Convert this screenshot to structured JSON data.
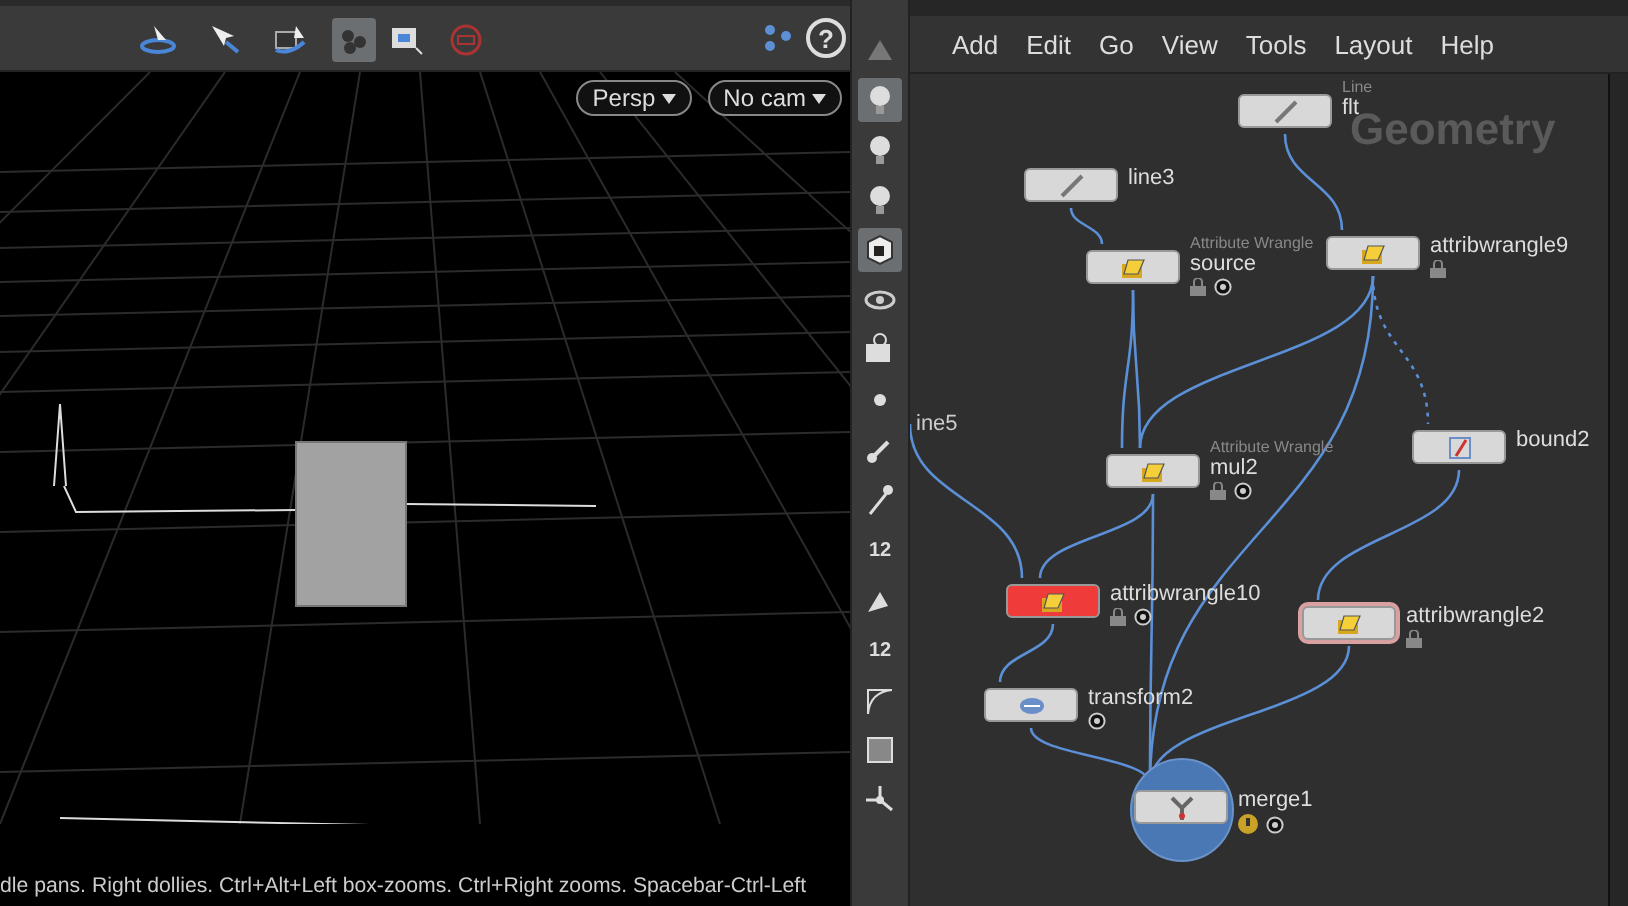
{
  "viewport": {
    "toolbar": [
      {
        "kind": "orbit",
        "selected": false
      },
      {
        "kind": "select",
        "selected": false
      },
      {
        "kind": "transform",
        "selected": false
      },
      {
        "kind": "snap",
        "selected": true
      },
      {
        "kind": "zoom",
        "selected": false
      },
      {
        "kind": "record",
        "selected": false
      }
    ],
    "help": "?",
    "camera_menus": [
      "Persp",
      "No cam"
    ],
    "status": "dle pans. Right dollies. Ctrl+Alt+Left box-zooms. Ctrl+Right zooms. Spacebar-Ctrl-Left"
  },
  "tools": [
    {
      "kind": "up",
      "selected": false
    },
    {
      "kind": "bulb",
      "selected": true
    },
    {
      "kind": "bulb",
      "selected": false
    },
    {
      "kind": "bulb",
      "selected": false
    },
    {
      "kind": "cube",
      "selected": true
    },
    {
      "kind": "eye",
      "selected": false
    },
    {
      "kind": "camera",
      "selected": false
    },
    {
      "kind": "dot",
      "selected": false
    },
    {
      "kind": "brush",
      "selected": false
    },
    {
      "kind": "pin",
      "selected": false
    },
    {
      "kind": "number",
      "text": "12",
      "selected": false
    },
    {
      "kind": "paint",
      "selected": false
    },
    {
      "kind": "number",
      "text": "12",
      "selected": false
    },
    {
      "kind": "curve",
      "selected": false
    },
    {
      "kind": "square",
      "selected": false
    },
    {
      "kind": "axes",
      "selected": false
    }
  ],
  "network": {
    "menu": [
      "Add",
      "Edit",
      "Go",
      "View",
      "Tools",
      "Layout",
      "Help"
    ],
    "context_label": "Geometry",
    "edge_label": "ine5",
    "nodes": [
      {
        "name": "flt",
        "type_label": "Line",
        "kind": "line",
        "color": "#d8d8d8",
        "locked": false,
        "flagged": false,
        "warning": false,
        "selected": false,
        "outlined": false
      },
      {
        "name": "line3",
        "kind": "line",
        "color": "#d8d8d8",
        "locked": false,
        "flagged": false,
        "warning": false,
        "selected": false,
        "outlined": false
      },
      {
        "name": "source",
        "type_label": "Attribute Wrangle",
        "kind": "wrangle",
        "color": "#d8d8d8",
        "locked": true,
        "flagged": true,
        "warning": false,
        "selected": false,
        "outlined": false
      },
      {
        "name": "attribwrangle9",
        "kind": "wrangle",
        "color": "#d8d8d8",
        "locked": true,
        "flagged": false,
        "warning": false,
        "selected": false,
        "outlined": false
      },
      {
        "name": "mul2",
        "type_label": "Attribute Wrangle",
        "kind": "wrangle",
        "color": "#d8d8d8",
        "locked": true,
        "flagged": true,
        "warning": false,
        "selected": false,
        "outlined": false
      },
      {
        "name": "bound2",
        "kind": "bound",
        "color": "#d8d8d8",
        "locked": false,
        "flagged": false,
        "warning": false,
        "selected": false,
        "outlined": false
      },
      {
        "name": "attribwrangle10",
        "kind": "wrangle",
        "color": "#f03b3b",
        "locked": true,
        "flagged": true,
        "warning": false,
        "selected": false,
        "outlined": false
      },
      {
        "name": "attribwrangle2",
        "kind": "wrangle",
        "color": "#d8d8d8",
        "locked": true,
        "flagged": false,
        "warning": false,
        "selected": false,
        "outlined": true
      },
      {
        "name": "transform2",
        "kind": "transform",
        "color": "#d8d8d8",
        "locked": false,
        "flagged": true,
        "warning": false,
        "selected": false,
        "outlined": false
      },
      {
        "name": "merge1",
        "kind": "merge",
        "color": "#d8d8d8",
        "locked": false,
        "flagged": true,
        "warning": true,
        "selected": true,
        "outlined": false
      }
    ]
  }
}
